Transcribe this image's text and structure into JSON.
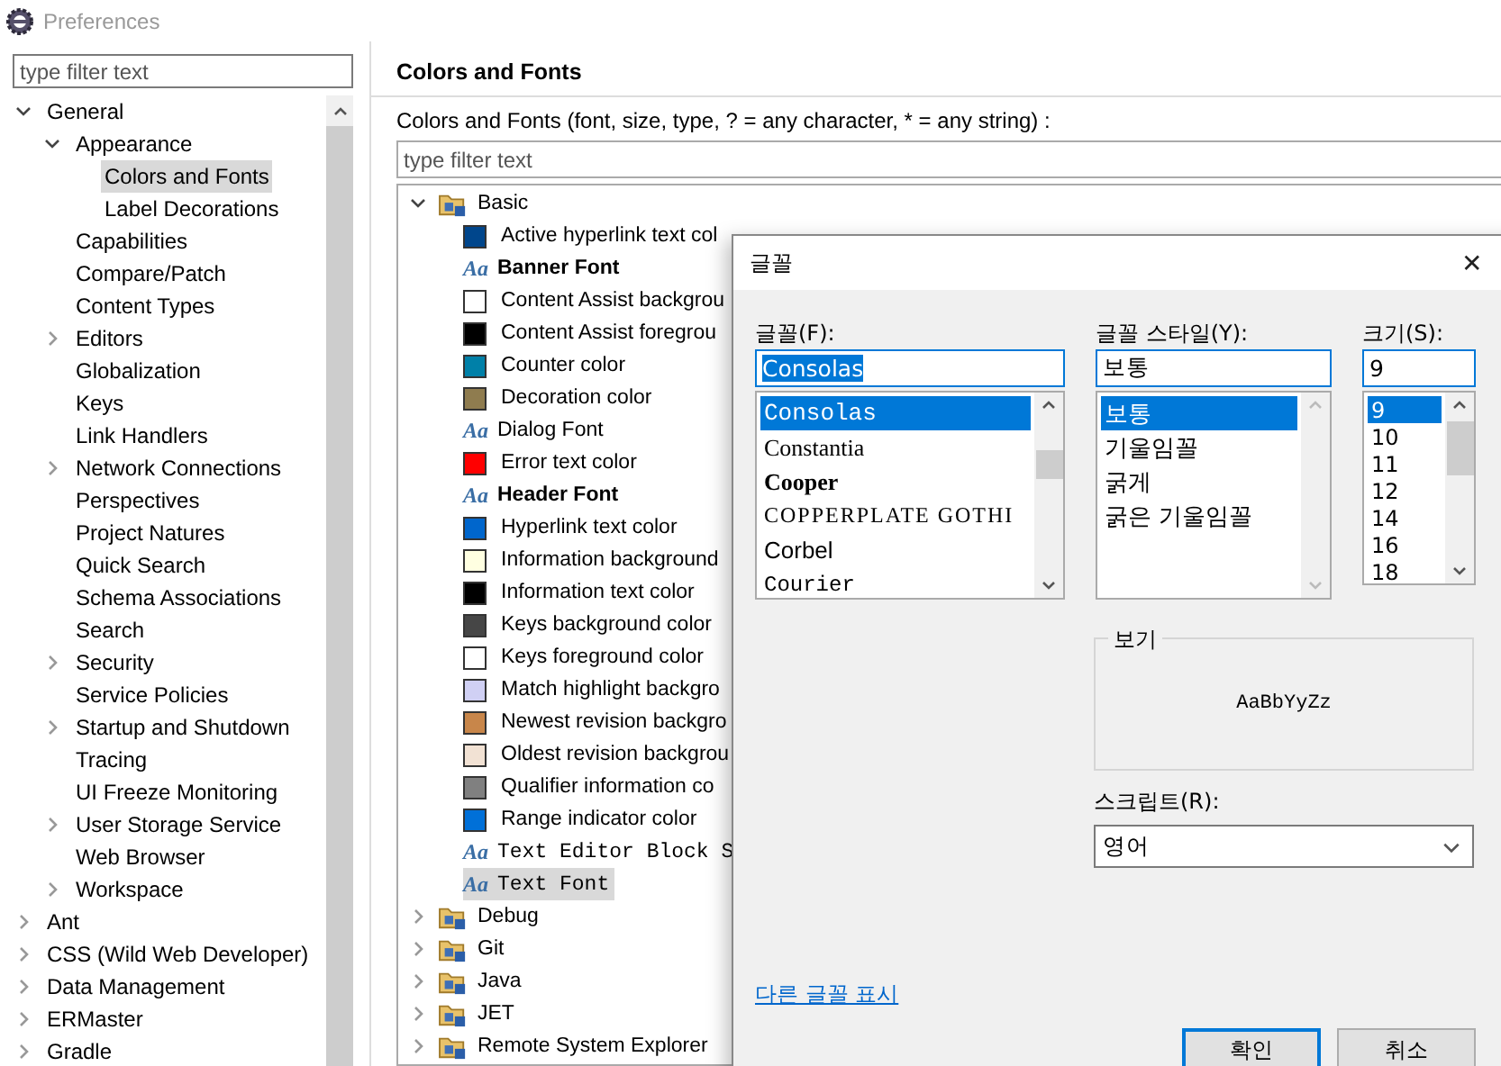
{
  "window": {
    "title": "Preferences"
  },
  "sidebar": {
    "filter": {
      "placeholder": "type filter text"
    },
    "tree": [
      {
        "label": "General",
        "expanded": true,
        "selected": false,
        "children": [
          {
            "label": "Appearance",
            "expanded": true,
            "selected": false,
            "children": [
              {
                "label": "Colors and Fonts",
                "selected": true
              },
              {
                "label": "Label Decorations",
                "selected": false
              }
            ]
          },
          {
            "label": "Capabilities",
            "selected": false
          },
          {
            "label": "Compare/Patch",
            "selected": false
          },
          {
            "label": "Content Types",
            "selected": false
          },
          {
            "label": "Editors",
            "expanded": false,
            "selected": false
          },
          {
            "label": "Globalization",
            "selected": false
          },
          {
            "label": "Keys",
            "selected": false
          },
          {
            "label": "Link Handlers",
            "selected": false
          },
          {
            "label": "Network Connections",
            "expanded": false,
            "selected": false
          },
          {
            "label": "Perspectives",
            "selected": false
          },
          {
            "label": "Project Natures",
            "selected": false
          },
          {
            "label": "Quick Search",
            "selected": false
          },
          {
            "label": "Schema Associations",
            "selected": false
          },
          {
            "label": "Search",
            "selected": false
          },
          {
            "label": "Security",
            "expanded": false,
            "selected": false
          },
          {
            "label": "Service Policies",
            "selected": false
          },
          {
            "label": "Startup and Shutdown",
            "expanded": false,
            "selected": false
          },
          {
            "label": "Tracing",
            "selected": false
          },
          {
            "label": "UI Freeze Monitoring",
            "selected": false
          },
          {
            "label": "User Storage Service",
            "expanded": false,
            "selected": false
          },
          {
            "label": "Web Browser",
            "selected": false
          },
          {
            "label": "Workspace",
            "expanded": false,
            "selected": false
          }
        ]
      },
      {
        "label": "Ant",
        "expanded": false,
        "selected": false
      },
      {
        "label": "CSS (Wild Web Developer)",
        "expanded": false,
        "selected": false
      },
      {
        "label": "Data Management",
        "expanded": false,
        "selected": false
      },
      {
        "label": "ERMaster",
        "expanded": false,
        "selected": false
      },
      {
        "label": "Gradle",
        "expanded": false,
        "selected": false
      }
    ]
  },
  "page": {
    "title": "Colors and Fonts",
    "description": "Colors and Fonts (font, size, type, ? = any character, * = any string) :",
    "filter": {
      "placeholder": "type filter text"
    },
    "categories": [
      {
        "label": "Basic",
        "expanded": true,
        "items": [
          {
            "kind": "color",
            "label": "Active hyperlink text col",
            "color": "#00468c",
            "selected": false
          },
          {
            "kind": "bold-font",
            "icon_glyph": "Aa",
            "label": "Banner Font",
            "selected": false
          },
          {
            "kind": "color",
            "label": "Content Assist backgrou",
            "color": "#ffffff",
            "selected": false
          },
          {
            "kind": "color",
            "label": "Content Assist foregrou",
            "color": "#000000",
            "selected": false
          },
          {
            "kind": "color",
            "label": "Counter color",
            "color": "#0080a8",
            "selected": false
          },
          {
            "kind": "color",
            "label": "Decoration color",
            "color": "#8f7c4f",
            "selected": false
          },
          {
            "kind": "font",
            "icon_glyph": "Aa",
            "label": "Dialog Font",
            "selected": false
          },
          {
            "kind": "color",
            "label": "Error text color",
            "color": "#ff0000",
            "selected": false
          },
          {
            "kind": "bold-font",
            "icon_glyph": "Aa",
            "label": "Header Font",
            "selected": false
          },
          {
            "kind": "color",
            "label": "Hyperlink text color",
            "color": "#0066cc",
            "selected": false
          },
          {
            "kind": "color",
            "label": "Information background",
            "color": "#ffffe1",
            "selected": false
          },
          {
            "kind": "color",
            "label": "Information text color",
            "color": "#000000",
            "selected": false
          },
          {
            "kind": "color",
            "label": "Keys background color",
            "color": "#464646",
            "selected": false
          },
          {
            "kind": "color",
            "label": "Keys foreground color",
            "color": "#ffffff",
            "selected": false
          },
          {
            "kind": "color",
            "label": "Match highlight backgro",
            "color": "#d0d0f4",
            "selected": false
          },
          {
            "kind": "color",
            "label": "Newest revision backgro",
            "color": "#c8864a",
            "selected": false
          },
          {
            "kind": "color",
            "label": "Oldest revision backgrou",
            "color": "#f2e2d4",
            "selected": false
          },
          {
            "kind": "color",
            "label": "Qualifier information co",
            "color": "#808080",
            "selected": false
          },
          {
            "kind": "color",
            "label": "Range indicator color",
            "color": "#0070d8",
            "selected": false
          },
          {
            "kind": "mono-font",
            "icon_glyph": "Aa",
            "label": "Text Editor Block S",
            "selected": false
          },
          {
            "kind": "mono-font",
            "icon_glyph": "Aa",
            "label": "Text Font",
            "selected": true
          }
        ]
      },
      {
        "label": "Debug",
        "expanded": false
      },
      {
        "label": "Git",
        "expanded": false
      },
      {
        "label": "Java",
        "expanded": false
      },
      {
        "label": "JET",
        "expanded": false
      },
      {
        "label": "Remote System Explorer",
        "expanded": false
      }
    ]
  },
  "dialog": {
    "title": "글꼴",
    "close": "✕",
    "font": {
      "label": "글꼴(F):",
      "value": "Consolas",
      "value_selected": true,
      "options": [
        {
          "label": "Consolas",
          "kind": "mono",
          "selected": true
        },
        {
          "label": "Constantia",
          "kind": "serif",
          "selected": false
        },
        {
          "label": "Cooper",
          "kind": "serif-bold",
          "selected": false
        },
        {
          "label": "COPPERPLATE GOTHI",
          "kind": "caps",
          "selected": false
        },
        {
          "label": "Corbel",
          "kind": "sans",
          "selected": false
        },
        {
          "label": "Courier",
          "kind": "typewriter",
          "selected": false
        }
      ]
    },
    "style": {
      "label": "글꼴 스타일(Y):",
      "value": "보통",
      "options": [
        {
          "label": "보통",
          "selected": true
        },
        {
          "label": "기울임꼴",
          "selected": false
        },
        {
          "label": "굵게",
          "selected": false
        },
        {
          "label": "굵은 기울임꼴",
          "selected": false
        }
      ]
    },
    "size": {
      "label": "크기(S):",
      "value": "9",
      "options": [
        {
          "label": "9",
          "selected": true
        },
        {
          "label": "10",
          "selected": false
        },
        {
          "label": "11",
          "selected": false
        },
        {
          "label": "12",
          "selected": false
        },
        {
          "label": "14",
          "selected": false
        },
        {
          "label": "16",
          "selected": false
        },
        {
          "label": "18",
          "selected": false
        }
      ]
    },
    "preview": {
      "label": "보기",
      "sample": "AaBbYyZz"
    },
    "script": {
      "label": "스크립트(R):",
      "value": "영어"
    },
    "link": "다른 글꼴 표시",
    "buttons": [
      {
        "label": "확인",
        "default": true
      },
      {
        "label": "취소",
        "default": false
      }
    ]
  }
}
